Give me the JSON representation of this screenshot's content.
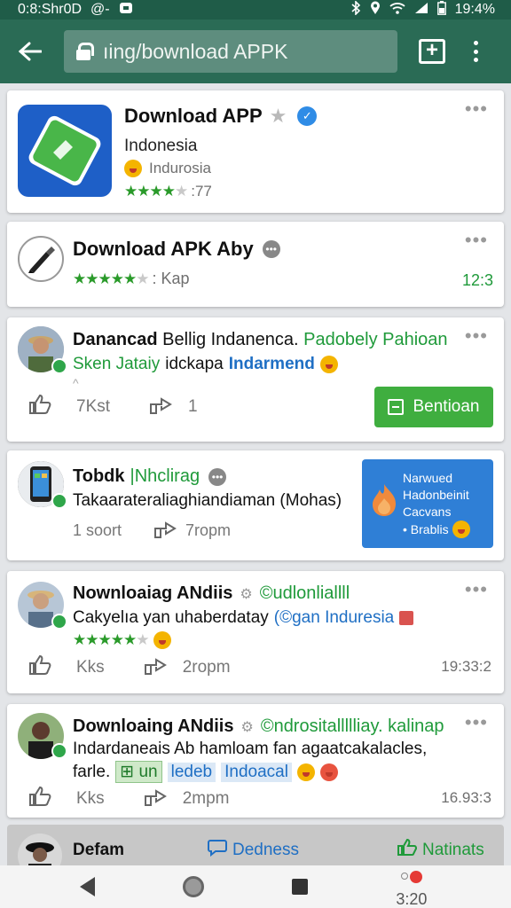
{
  "statusbar": {
    "left_text": "0:8:Shr0D",
    "sync_text": "@-",
    "battery_text": "19:4%"
  },
  "browser": {
    "url": "ıing/bownload APPK"
  },
  "cards": [
    {
      "title": "Download APP",
      "subtitle": "Indonesia",
      "detail": "Indurosia",
      "rating_text": ":77",
      "rating": 4
    },
    {
      "title": "Download APK Aby",
      "rating_text": ":  Kap",
      "rating": 5,
      "right_text": "12:3"
    },
    {
      "title": "Danancad",
      "title_rest": "Bellig Indanenca.",
      "title_green": "Padobely Pahioan",
      "line2_green": "Sken Jataiy",
      "line2_plain": "idckapa",
      "line2_blue": "Indarmend",
      "like_count": "7Kst",
      "share_count": "1",
      "button_label": "Bentioan"
    },
    {
      "title": "Tobdk",
      "title_rest": "|Nhclirag",
      "line2": "Takaarateraliaghiandiaman (Mohas)",
      "stat1": "1 soort",
      "stat2": "7ropm",
      "promo_lines": [
        "Narwued",
        "Hadonbeinit",
        "Cacvans",
        "• Brablis"
      ]
    },
    {
      "title": "Nownloaiag ANdiis",
      "title_green": "©udlonliallll",
      "line2_plain": "Cakyelıa yan uhaberdatay",
      "line2_blue": "(©gan Induresia",
      "rating": 5,
      "like_count": "Kks",
      "share_count": "2ropm",
      "time": "19:33:2"
    },
    {
      "title": "Downloaing ANdiis",
      "title_green": "©ndrositallllliay. kalinap",
      "line2": "Indardaneais Ab hamloam fan agaatcakalacles,",
      "line3_plain": "farle.",
      "tag1": "⊞ un",
      "tag2": "ledeb",
      "tag3": "Indoacal",
      "like_count": "Kks",
      "share_count": "2mpm",
      "time": "16.93:3"
    }
  ],
  "bottom_preview": {
    "name": "Defam",
    "tab1": "Dedness",
    "tab2": "Natinats"
  },
  "navbar": {
    "time": "3:20"
  },
  "colors": {
    "appbar": "#2a6b55",
    "statusbar": "#1f5c48",
    "green_button": "#3fae3f",
    "promo_blue": "#2f7fd6"
  }
}
